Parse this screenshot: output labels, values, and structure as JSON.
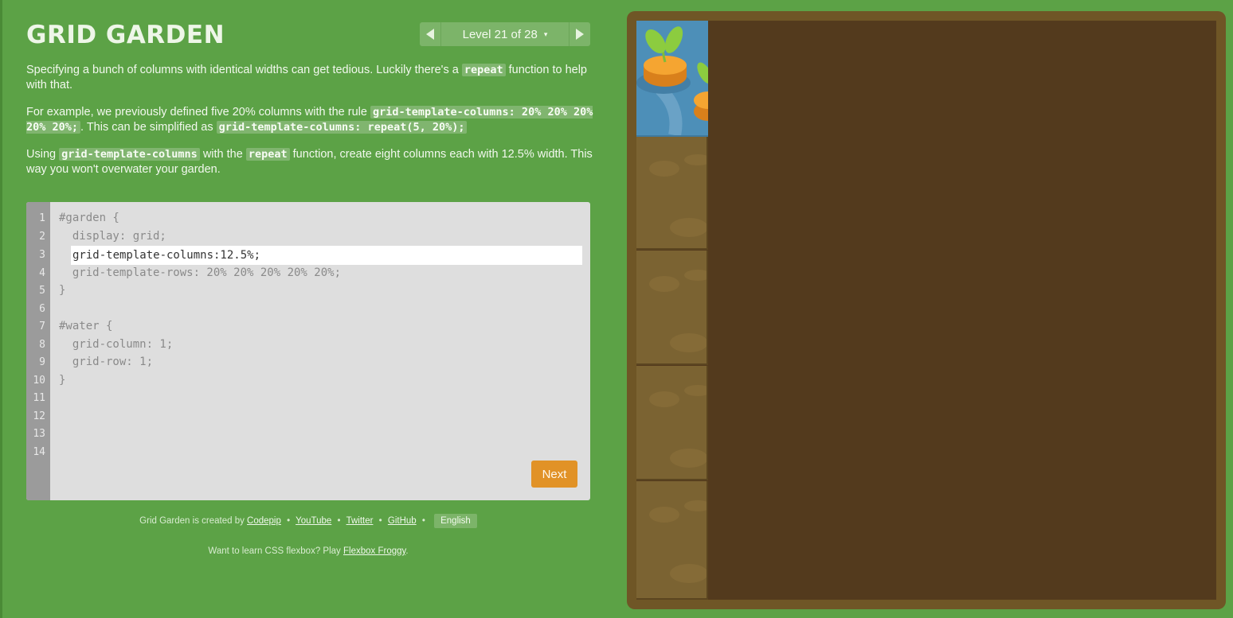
{
  "header": {
    "title": "GRID GARDEN",
    "level_label": "Level 21 of 28",
    "caret": "▾"
  },
  "instructions": {
    "p1_text_a": "Specifying a bunch of columns with identical widths can get tedious. Luckily there's a",
    "p1_code": "repeat",
    "p1_text_b": "function to help with that.",
    "p2_text_a": "For example, we previously defined five 20% columns with the rule",
    "p2_code_a": "grid-template-columns: 20% 20% 20% 20% 20%;",
    "p2_text_b": ". This can be simplified as",
    "p2_code_b": "grid-template-columns: repeat(5, 20%);",
    "p3_text_a": "Using",
    "p3_code_a": "grid-template-columns",
    "p3_text_b": "with the",
    "p3_code_b": "repeat",
    "p3_text_c": "function, create eight columns each with 12.5% width. This way you won't overwater your garden."
  },
  "editor": {
    "line_numbers": [
      "1",
      "2",
      "3",
      "4",
      "5",
      "6",
      "7",
      "8",
      "9",
      "10",
      "11",
      "12",
      "13",
      "14"
    ],
    "line1": "#garden {",
    "line2": "  display: grid;",
    "line4": "  grid-template-rows: 20% 20% 20% 20% 20%;",
    "line5": "}",
    "line7": "#water {",
    "line8": "  grid-column: 1;",
    "line9": "  grid-row: 1;",
    "line10": "}",
    "input_value": "grid-template-columns:12.5%;",
    "next_label": "Next"
  },
  "footer": {
    "created_by": "Grid Garden is created by",
    "codepip": "Codepip",
    "youtube": "YouTube",
    "twitter": "Twitter",
    "github": "GitHub",
    "bullet": "•",
    "language": "English",
    "froggy_text": "Want to learn CSS flexbox? Play",
    "froggy_link": "Flexbox Froggy",
    "period": "."
  },
  "board": {
    "water_color": "#4d8fb8",
    "soil_color": "#533a1d",
    "plot_color": "#7b6332",
    "frame_color": "#6f5626"
  }
}
